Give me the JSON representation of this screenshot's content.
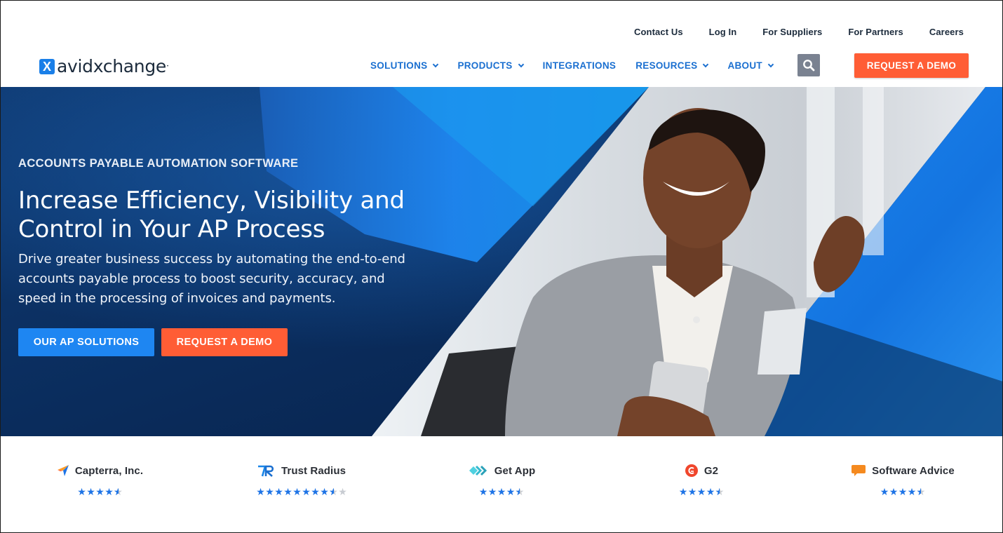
{
  "brand": {
    "name": "avidxchange",
    "logo_mark": "X",
    "colors": {
      "primary_blue": "#1a6fd0",
      "accent_orange": "#ff5d35",
      "hero_navy": "#0a2a56",
      "button_blue": "#1e86f2",
      "star_blue": "#1e74e6"
    }
  },
  "utility_nav": [
    "Contact Us",
    "Log In",
    "For Suppliers",
    "For Partners",
    "Careers"
  ],
  "main_nav": [
    {
      "label": "SOLUTIONS",
      "has_dropdown": true
    },
    {
      "label": "PRODUCTS",
      "has_dropdown": true
    },
    {
      "label": "INTEGRATIONS",
      "has_dropdown": false
    },
    {
      "label": "RESOURCES",
      "has_dropdown": true
    },
    {
      "label": "ABOUT",
      "has_dropdown": true
    }
  ],
  "header": {
    "search_icon": "search-icon",
    "demo_button": "REQUEST A DEMO"
  },
  "hero": {
    "eyebrow": "ACCOUNTS PAYABLE AUTOMATION SOFTWARE",
    "headline_line1": "Increase Efficiency, Visibility and",
    "headline_line2": "Control in Your AP Process",
    "subtext": "Drive greater business success by automating the end-to-end accounts payable process to boost security, accuracy, and speed in the processing of invoices and payments.",
    "primary_cta": "OUR AP SOLUTIONS",
    "secondary_cta": "REQUEST A DEMO",
    "image_alt": "Smiling businesswoman in grey blazer holding a phone"
  },
  "ratings": [
    {
      "name": "Capterra, Inc.",
      "icon": "capterra-icon",
      "rating": 4.5,
      "max": 5
    },
    {
      "name": "Trust Radius",
      "icon": "trustradius-icon",
      "rating": 8.5,
      "max": 10
    },
    {
      "name": "Get App",
      "icon": "getapp-icon",
      "rating": 4.5,
      "max": 5
    },
    {
      "name": "G2",
      "icon": "g2-icon",
      "rating": 4.5,
      "max": 5
    },
    {
      "name": "Software Advice",
      "icon": "softwareadvice-icon",
      "rating": 4.5,
      "max": 5
    }
  ]
}
